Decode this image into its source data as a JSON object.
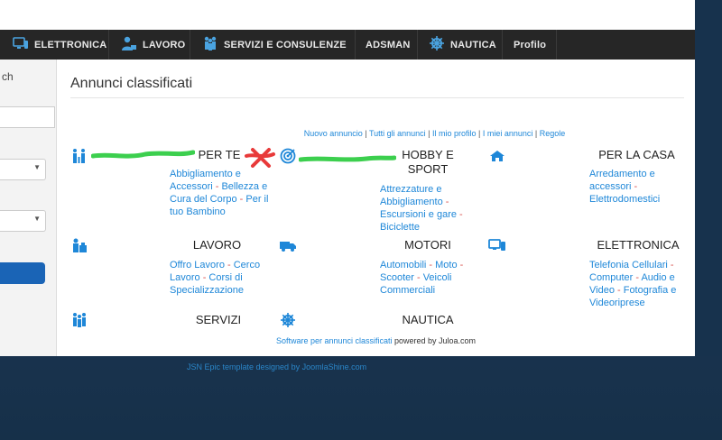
{
  "nav": {
    "items": [
      {
        "label": "ELETTRONICA",
        "icon": "monitor-icon"
      },
      {
        "label": "LAVORO",
        "icon": "worker-icon"
      },
      {
        "label": "SERVIZI E CONSULENZE",
        "icon": "people-icon"
      },
      {
        "label": "ADSMAN",
        "icon": ""
      },
      {
        "label": "NAUTICA",
        "icon": "ship-wheel-icon"
      },
      {
        "label": "Profilo",
        "icon": ""
      }
    ]
  },
  "sidebar": {
    "search_label_fragment": "ch"
  },
  "main": {
    "title": "Annunci classificati",
    "links": [
      "Nuovo annuncio",
      "Tutti gli annunci",
      "Il mio profilo",
      "I miei annunci",
      "Regole"
    ],
    "categories": [
      {
        "title": "PER TE",
        "icon": "family-icon",
        "items": [
          "Abbigliamento e Accessori",
          "Bellezza e Cura del Corpo",
          "Per il tuo Bambino"
        ]
      },
      {
        "title": "HOBBY E SPORT",
        "icon": "target-icon",
        "items": [
          "Attrezzature e Abbigliamento",
          "Escursioni e gare",
          "Biciclette"
        ]
      },
      {
        "title": "PER LA CASA",
        "icon": "house-icon",
        "items": [
          "Arredamento e accessori",
          "Elettrodomestici"
        ]
      },
      {
        "title": "LAVORO",
        "icon": "worker-icon",
        "items": [
          "Offro Lavoro",
          "Cerco Lavoro",
          "Corsi di Specializzazione"
        ]
      },
      {
        "title": "MOTORI",
        "icon": "truck-icon",
        "items": [
          "Automobili",
          "Moto",
          "Scooter",
          "Veicoli Commerciali"
        ]
      },
      {
        "title": "ELETTRONICA",
        "icon": "devices-icon",
        "items": [
          "Telefonia Cellulari",
          "Computer",
          "Audio e Video",
          "Fotografia e Videoriprese"
        ]
      },
      {
        "title": "SERVIZI",
        "icon": "people-icon",
        "items": []
      },
      {
        "title": "NAUTICA",
        "icon": "ship-wheel-icon",
        "items": []
      }
    ],
    "footer": {
      "link_text": "Software per annunci classificati",
      "suffix": " powered by Juloa.com"
    }
  },
  "credit": "JSN Epic template designed by JoomlaShine.com",
  "colors": {
    "accent": "#1e87d8",
    "nav_bg": "#262626",
    "scribble_green": "#3ccf4e",
    "scribble_red": "#e83a3a",
    "button_blue": "#1a64b6"
  }
}
